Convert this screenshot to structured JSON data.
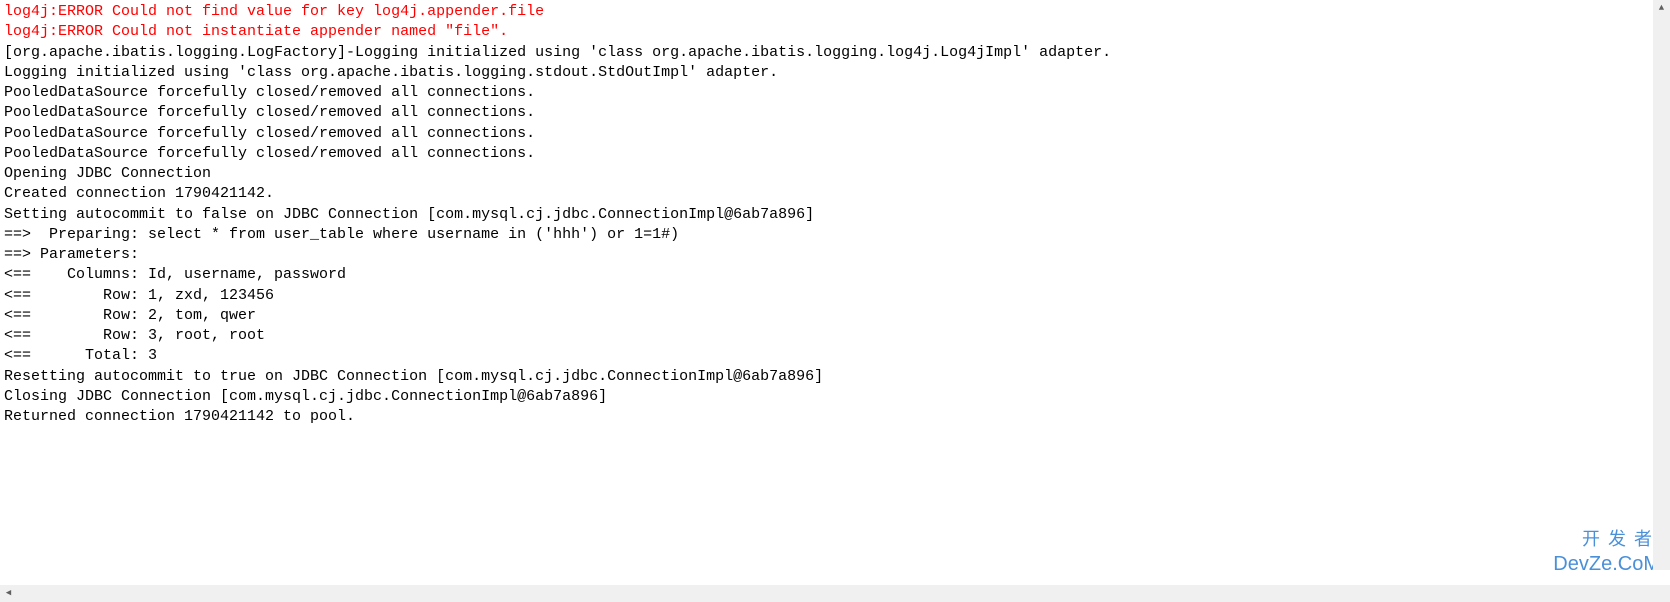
{
  "console": {
    "lines": [
      {
        "text": "log4j:ERROR Could not find value for key log4j.appender.file",
        "error": true
      },
      {
        "text": "log4j:ERROR Could not instantiate appender named \"file\".",
        "error": true
      },
      {
        "text": "[org.apache.ibatis.logging.LogFactory]-Logging initialized using 'class org.apache.ibatis.logging.log4j.Log4jImpl' adapter.",
        "error": false
      },
      {
        "text": "Logging initialized using 'class org.apache.ibatis.logging.stdout.StdOutImpl' adapter.",
        "error": false
      },
      {
        "text": "PooledDataSource forcefully closed/removed all connections.",
        "error": false
      },
      {
        "text": "PooledDataSource forcefully closed/removed all connections.",
        "error": false
      },
      {
        "text": "PooledDataSource forcefully closed/removed all connections.",
        "error": false
      },
      {
        "text": "PooledDataSource forcefully closed/removed all connections.",
        "error": false
      },
      {
        "text": "Opening JDBC Connection",
        "error": false
      },
      {
        "text": "Created connection 1790421142.",
        "error": false
      },
      {
        "text": "Setting autocommit to false on JDBC Connection [com.mysql.cj.jdbc.ConnectionImpl@6ab7a896]",
        "error": false
      },
      {
        "text": "==>  Preparing: select * from user_table where username in ('hhh') or 1=1#)",
        "error": false
      },
      {
        "text": "==> Parameters: ",
        "error": false
      },
      {
        "text": "<==    Columns: Id, username, password",
        "error": false
      },
      {
        "text": "<==        Row: 1, zxd, 123456",
        "error": false
      },
      {
        "text": "<==        Row: 2, tom, qwer",
        "error": false
      },
      {
        "text": "<==        Row: 3, root, root",
        "error": false
      },
      {
        "text": "<==      Total: 3",
        "error": false
      },
      {
        "text": "Resetting autocommit to true on JDBC Connection [com.mysql.cj.jdbc.ConnectionImpl@6ab7a896]",
        "error": false
      },
      {
        "text": "Closing JDBC Connection [com.mysql.cj.jdbc.ConnectionImpl@6ab7a896]",
        "error": false
      },
      {
        "text": "Returned connection 1790421142 to pool.",
        "error": false
      }
    ]
  },
  "watermark": {
    "top": "开发者",
    "bottom": "DevZe.CoM"
  },
  "scrollbar": {
    "up": "▲",
    "left": "◀"
  }
}
